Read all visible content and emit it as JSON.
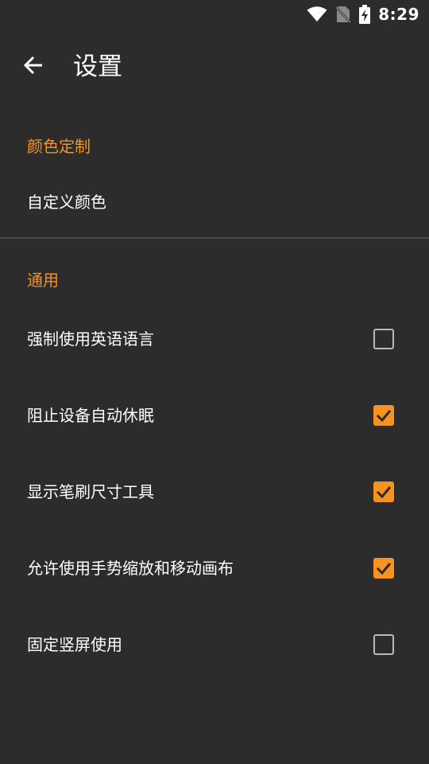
{
  "status_bar": {
    "time": "8:29",
    "icons": [
      "wifi-icon",
      "no-sim-icon",
      "battery-charging-icon"
    ]
  },
  "app_bar": {
    "back_icon": "arrow-left-icon",
    "title": "设置"
  },
  "sections": [
    {
      "header": "颜色定制",
      "items": [
        {
          "label": "自定义颜色"
        }
      ]
    },
    {
      "header": "通用",
      "items": [
        {
          "label": "强制使用英语语言",
          "checked": false
        },
        {
          "label": "阻止设备自动休眠",
          "checked": true
        },
        {
          "label": "显示笔刷尺寸工具",
          "checked": true
        },
        {
          "label": "允许使用手势缩放和移动画布",
          "checked": true
        },
        {
          "label": "固定竖屏使用",
          "checked": false
        }
      ]
    }
  ],
  "colors": {
    "background": "#2c2c2c",
    "accent": "#f7931e",
    "text": "#ffffff",
    "checkbox_border": "#b8b8b8",
    "divider": "#4a4a4a"
  }
}
